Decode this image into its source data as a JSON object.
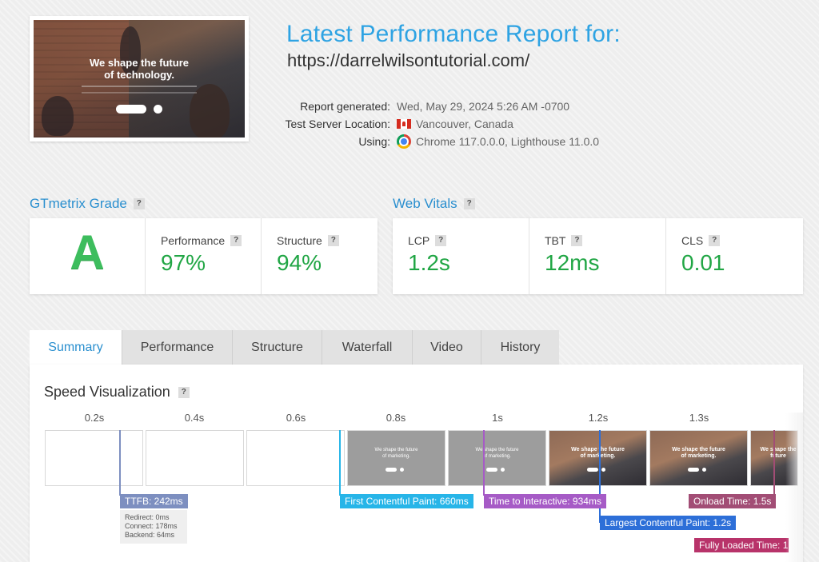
{
  "header": {
    "title": "Latest Performance Report for:",
    "url": "https://darrelwilsontutorial.com/",
    "thumbnail": {
      "headline_line1": "We shape the future",
      "headline_line2": "of technology."
    },
    "meta": [
      {
        "label": "Report generated:",
        "value": "Wed, May 29, 2024 5:26 AM -0700",
        "icon": ""
      },
      {
        "label": "Test Server Location:",
        "value": "Vancouver, Canada",
        "icon": "canada-flag-icon"
      },
      {
        "label": "Using:",
        "value": "Chrome 117.0.0.0, Lighthouse 11.0.0",
        "icon": "chrome-icon"
      }
    ]
  },
  "grade": {
    "title": "GTmetrix Grade",
    "letter": "A",
    "performance_label": "Performance",
    "performance_value": "97%",
    "structure_label": "Structure",
    "structure_value": "94%"
  },
  "vitals": {
    "title": "Web Vitals",
    "lcp_label": "LCP",
    "lcp_value": "1.2s",
    "tbt_label": "TBT",
    "tbt_value": "12ms",
    "cls_label": "CLS",
    "cls_value": "0.01"
  },
  "tabs": [
    "Summary",
    "Performance",
    "Structure",
    "Waterfall",
    "Video",
    "History"
  ],
  "speed": {
    "title": "Speed Visualization",
    "time_labels": [
      "0.2s",
      "0.4s",
      "0.6s",
      "0.8s",
      "1s",
      "1.2s",
      "1.3s"
    ],
    "frame_text_line1": "We shape the future",
    "frame_text_line2": "of marketing.",
    "markers": {
      "ttfb": "TTFB: 242ms",
      "fcp": "First Contentful Paint: 660ms",
      "tti": "Time to Interactive: 934ms",
      "lcp": "Largest Contentful Paint: 1.2s",
      "onload": "Onload Time: 1.5s",
      "fully_loaded": "Fully Loaded Time: 1."
    },
    "ttfb_detail": {
      "redirect": "Redirect: 0ms",
      "connect": "Connect: 178ms",
      "backend": "Backend: 64ms"
    }
  },
  "colors": {
    "accent": "#2ea3e3",
    "good": "#21a645",
    "ttfb": "#7d8fc0",
    "fcp": "#27b5e8",
    "tti": "#a65bc6",
    "lcp": "#2d6fd8",
    "onload": "#a24d75",
    "fully_loaded": "#b8336a"
  }
}
